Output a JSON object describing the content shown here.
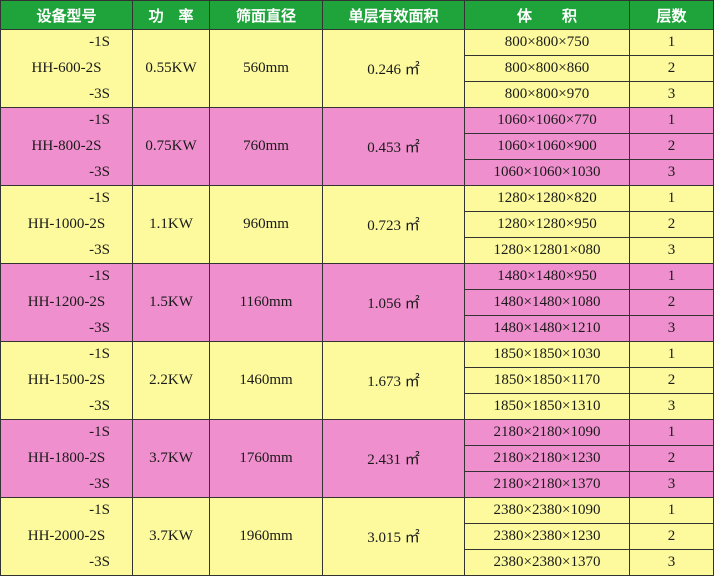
{
  "colors": {
    "header": "#1fa33b",
    "yellow": "#fcfa9c",
    "pink": "#f08fce"
  },
  "headers": [
    "设备型号",
    "功　率",
    "筛面直径",
    "单层有效面积",
    "体　　积",
    "层数"
  ],
  "area_unit": "㎡",
  "groups": [
    {
      "model": "HH-600-2S",
      "suffix_top": "-1S",
      "suffix_bottom": "-3S",
      "power": "0.55KW",
      "diameter": "560mm",
      "area": "0.246",
      "volumes": [
        "800×800×750",
        "800×800×860",
        "800×800×970"
      ],
      "layers": [
        "1",
        "2",
        "3"
      ]
    },
    {
      "model": "HH-800-2S",
      "suffix_top": "-1S",
      "suffix_bottom": "-3S",
      "power": "0.75KW",
      "diameter": "760mm",
      "area": "0.453",
      "volumes": [
        "1060×1060×770",
        "1060×1060×900",
        "1060×1060×1030"
      ],
      "layers": [
        "1",
        "2",
        "3"
      ]
    },
    {
      "model": "HH-1000-2S",
      "suffix_top": "-1S",
      "suffix_bottom": "-3S",
      "power": "1.1KW",
      "diameter": "960mm",
      "area": "0.723",
      "volumes": [
        "1280×1280×820",
        "1280×1280×950",
        "1280×12801×080"
      ],
      "layers": [
        "1",
        "2",
        "3"
      ]
    },
    {
      "model": "HH-1200-2S",
      "suffix_top": "-1S",
      "suffix_bottom": "-3S",
      "power": "1.5KW",
      "diameter": "1160mm",
      "area": "1.056",
      "volumes": [
        "1480×1480×950",
        "1480×1480×1080",
        "1480×1480×1210"
      ],
      "layers": [
        "1",
        "2",
        "3"
      ]
    },
    {
      "model": "HH-1500-2S",
      "suffix_top": "-1S",
      "suffix_bottom": "-3S",
      "power": "2.2KW",
      "diameter": "1460mm",
      "area": "1.673",
      "volumes": [
        "1850×1850×1030",
        "1850×1850×1170",
        "1850×1850×1310"
      ],
      "layers": [
        "1",
        "2",
        "3"
      ]
    },
    {
      "model": "HH-1800-2S",
      "suffix_top": "-1S",
      "suffix_bottom": "-3S",
      "power": "3.7KW",
      "diameter": "1760mm",
      "area": "2.431",
      "volumes": [
        "2180×2180×1090",
        "2180×2180×1230",
        "2180×2180×1370"
      ],
      "layers": [
        "1",
        "2",
        "3"
      ]
    },
    {
      "model": "HH-2000-2S",
      "suffix_top": "-1S",
      "suffix_bottom": "-3S",
      "power": "3.7KW",
      "diameter": "1960mm",
      "area": "3.015",
      "volumes": [
        "2380×2380×1090",
        "2380×2380×1230",
        "2380×2380×1370"
      ],
      "layers": [
        "1",
        "2",
        "3"
      ]
    }
  ]
}
